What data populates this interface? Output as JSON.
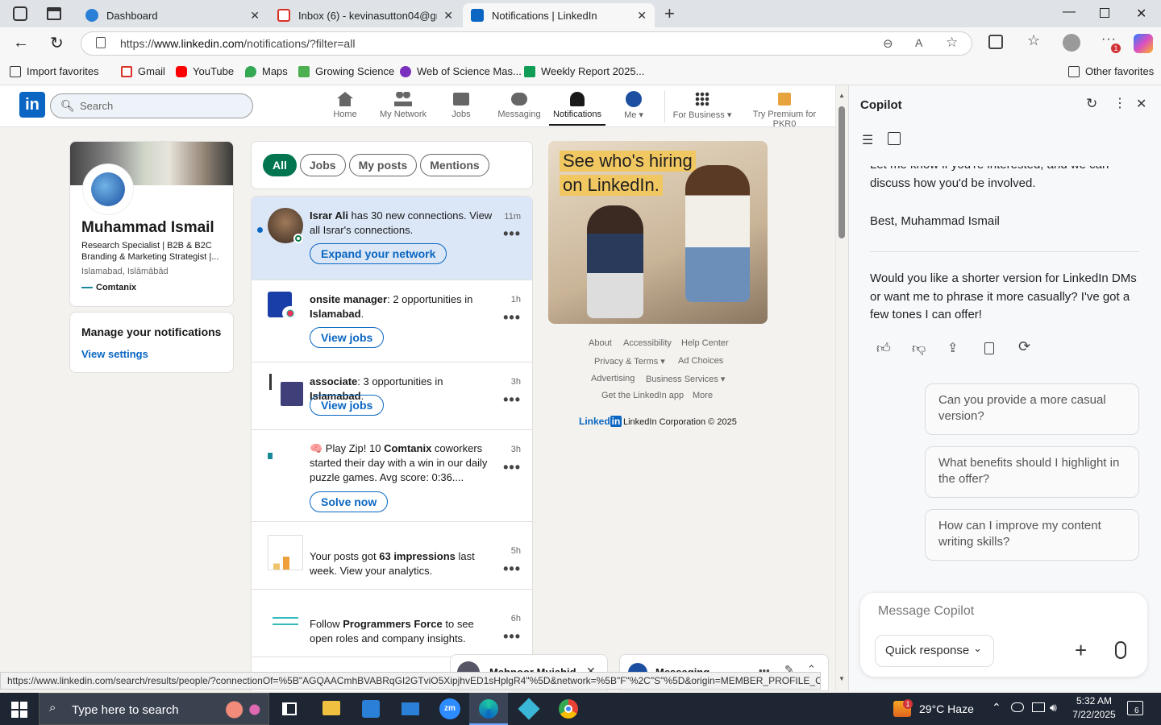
{
  "browser": {
    "tabs": [
      {
        "title": "Dashboard",
        "color": "#2a7fd6"
      },
      {
        "title": "Inbox (6) - kevinasutton04@gmail",
        "color": "#d93025"
      },
      {
        "title": "Notifications | LinkedIn",
        "color": "#0a66c2"
      }
    ],
    "url_prefix": "https://",
    "url_host": "www.linkedin.com",
    "url_path": "/notifications/?filter=all",
    "favorites": [
      "Import favorites",
      "Gmail",
      "YouTube",
      "Maps",
      "Growing Science",
      "Web of Science Mas...",
      "Weekly Report 2025..."
    ],
    "other_favorites": "Other favorites",
    "status_url": "https://www.linkedin.com/search/results/people/?connectionOf=%5B\"AGQAACmhBVABRqGI2GTviO5XipjhvED1sHplgR4\"%5D&network=%5B\"F\"%2C\"S\"%5D&origin=MEMBER_PROFILE_CA..."
  },
  "linkedin": {
    "search_placeholder": "Search",
    "nav": [
      "Home",
      "My Network",
      "Jobs",
      "Messaging",
      "Notifications",
      "Me",
      "For Business",
      "Try Premium for PKR0"
    ],
    "profile": {
      "name": "Muhammad Ismail",
      "headline": "Research Specialist | B2B & B2C Branding & Marketing Strategist |...",
      "location": "Islamabad, Islāmābād",
      "company": "Comtanix"
    },
    "manage": {
      "title": "Manage your notifications",
      "link": "View settings"
    },
    "filters": [
      "All",
      "Jobs",
      "My posts",
      "Mentions"
    ],
    "notifications": [
      {
        "pre": "",
        "bold": "Israr Ali",
        "text": " has 30 new connections. View all Israr's connections.",
        "time": "11m",
        "button": "Expand your network"
      },
      {
        "pre": "",
        "bold": "onsite manager",
        "text": ": 2 opportunities in ",
        "bold2": "Islamabad",
        "post": ".",
        "time": "1h",
        "button": "View jobs"
      },
      {
        "pre": "",
        "bold": "associate",
        "text": ": 3 opportunities in ",
        "bold2": "Islamabad",
        "post": ".",
        "time": "3h",
        "button": "View jobs"
      },
      {
        "pre": "🧠 Play Zip! 10 ",
        "bold": "Comtanix",
        "text": " coworkers started their day with a win in our daily puzzle games. Avg score: 0:36....",
        "time": "3h",
        "button": "Solve now"
      },
      {
        "pre": "Your posts got ",
        "bold": "63 impressions",
        "text": " last week. View your analytics.",
        "time": "5h"
      },
      {
        "pre": "Follow ",
        "bold": "Programmers Force",
        "text": " to see open roles and company insights.",
        "time": "6h"
      }
    ],
    "ad": {
      "line1": "See who's hiring",
      "line2": "on LinkedIn."
    },
    "footer_links": [
      "About",
      "Accessibility",
      "Help Center",
      "Privacy & Terms ▾",
      "Ad Choices",
      "Advertising",
      "Business Services ▾",
      "Get the LinkedIn app",
      "More"
    ],
    "copyright": "LinkedIn Corporation © 2025",
    "msg_bubbles": [
      "Mahnoor Mujahid",
      "Messaging"
    ]
  },
  "copilot": {
    "title": "Copilot",
    "cut_text": "Let me know if you're interested, and we can discuss how you'd be involved.",
    "signoff": "Best, Muhammad Ismail",
    "question": "Would you like a shorter version for LinkedIn DMs or want me to phrase it more casually? I've got a few tones I can offer!",
    "suggestions": [
      "Can you provide a more casual version?",
      "What benefits should I highlight in the offer?",
      "How can I improve my content writing skills?"
    ],
    "input_placeholder": "Message Copilot",
    "mode": "Quick response"
  },
  "taskbar": {
    "search": "Type here to search",
    "weather": "29°C  Haze",
    "time": "5:32 AM",
    "date": "7/22/2025",
    "notif_count": "6"
  }
}
